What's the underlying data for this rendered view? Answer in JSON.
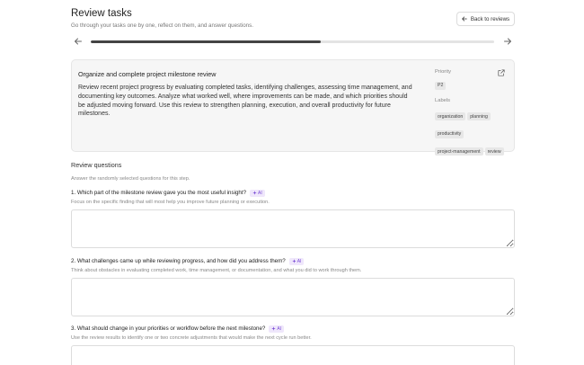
{
  "header": {
    "title": "Review tasks",
    "subtitle": "Go through your tasks one by one, reflect on them, and answer questions.",
    "back_label": "Back to reviews"
  },
  "progress": {
    "fraction": 0.57
  },
  "task": {
    "title": "Organize and complete project milestone review",
    "description": "Review recent project progress by evaluating completed tasks, identifying challenges, assessing time management, and documenting key outcomes. Analyze what worked well, where improvements can be made, and which priorities should be adjusted moving forward. Use this review to strengthen planning, execution, and overall productivity for future milestones.",
    "priority_label": "Priority",
    "priority": "P2",
    "labels_label": "Labels",
    "labels": [
      "organization",
      "planning",
      "productivity",
      "project-management",
      "review"
    ]
  },
  "review": {
    "title": "Review questions",
    "subtitle": "Answer the randomly selected questions for this step.",
    "ai_label": "AI",
    "questions": [
      {
        "text": "1. Which part of the milestone review gave you the most useful insight?",
        "hint": "Focus on the specific finding that will most help you improve future planning or execution."
      },
      {
        "text": "2. What challenges came up while reviewing progress, and how did you address them?",
        "hint": "Think about obstacles in evaluating completed work, time management, or documentation, and what you did to work through them."
      },
      {
        "text": "3. What should change in your priorities or workflow before the next milestone?",
        "hint": "Use the review results to identify one or two concrete adjustments that would make the next cycle run better."
      }
    ]
  },
  "colors": {
    "accent": "#7a4bd6",
    "ai_bg": "#efe7fb",
    "progress": "#444444"
  }
}
